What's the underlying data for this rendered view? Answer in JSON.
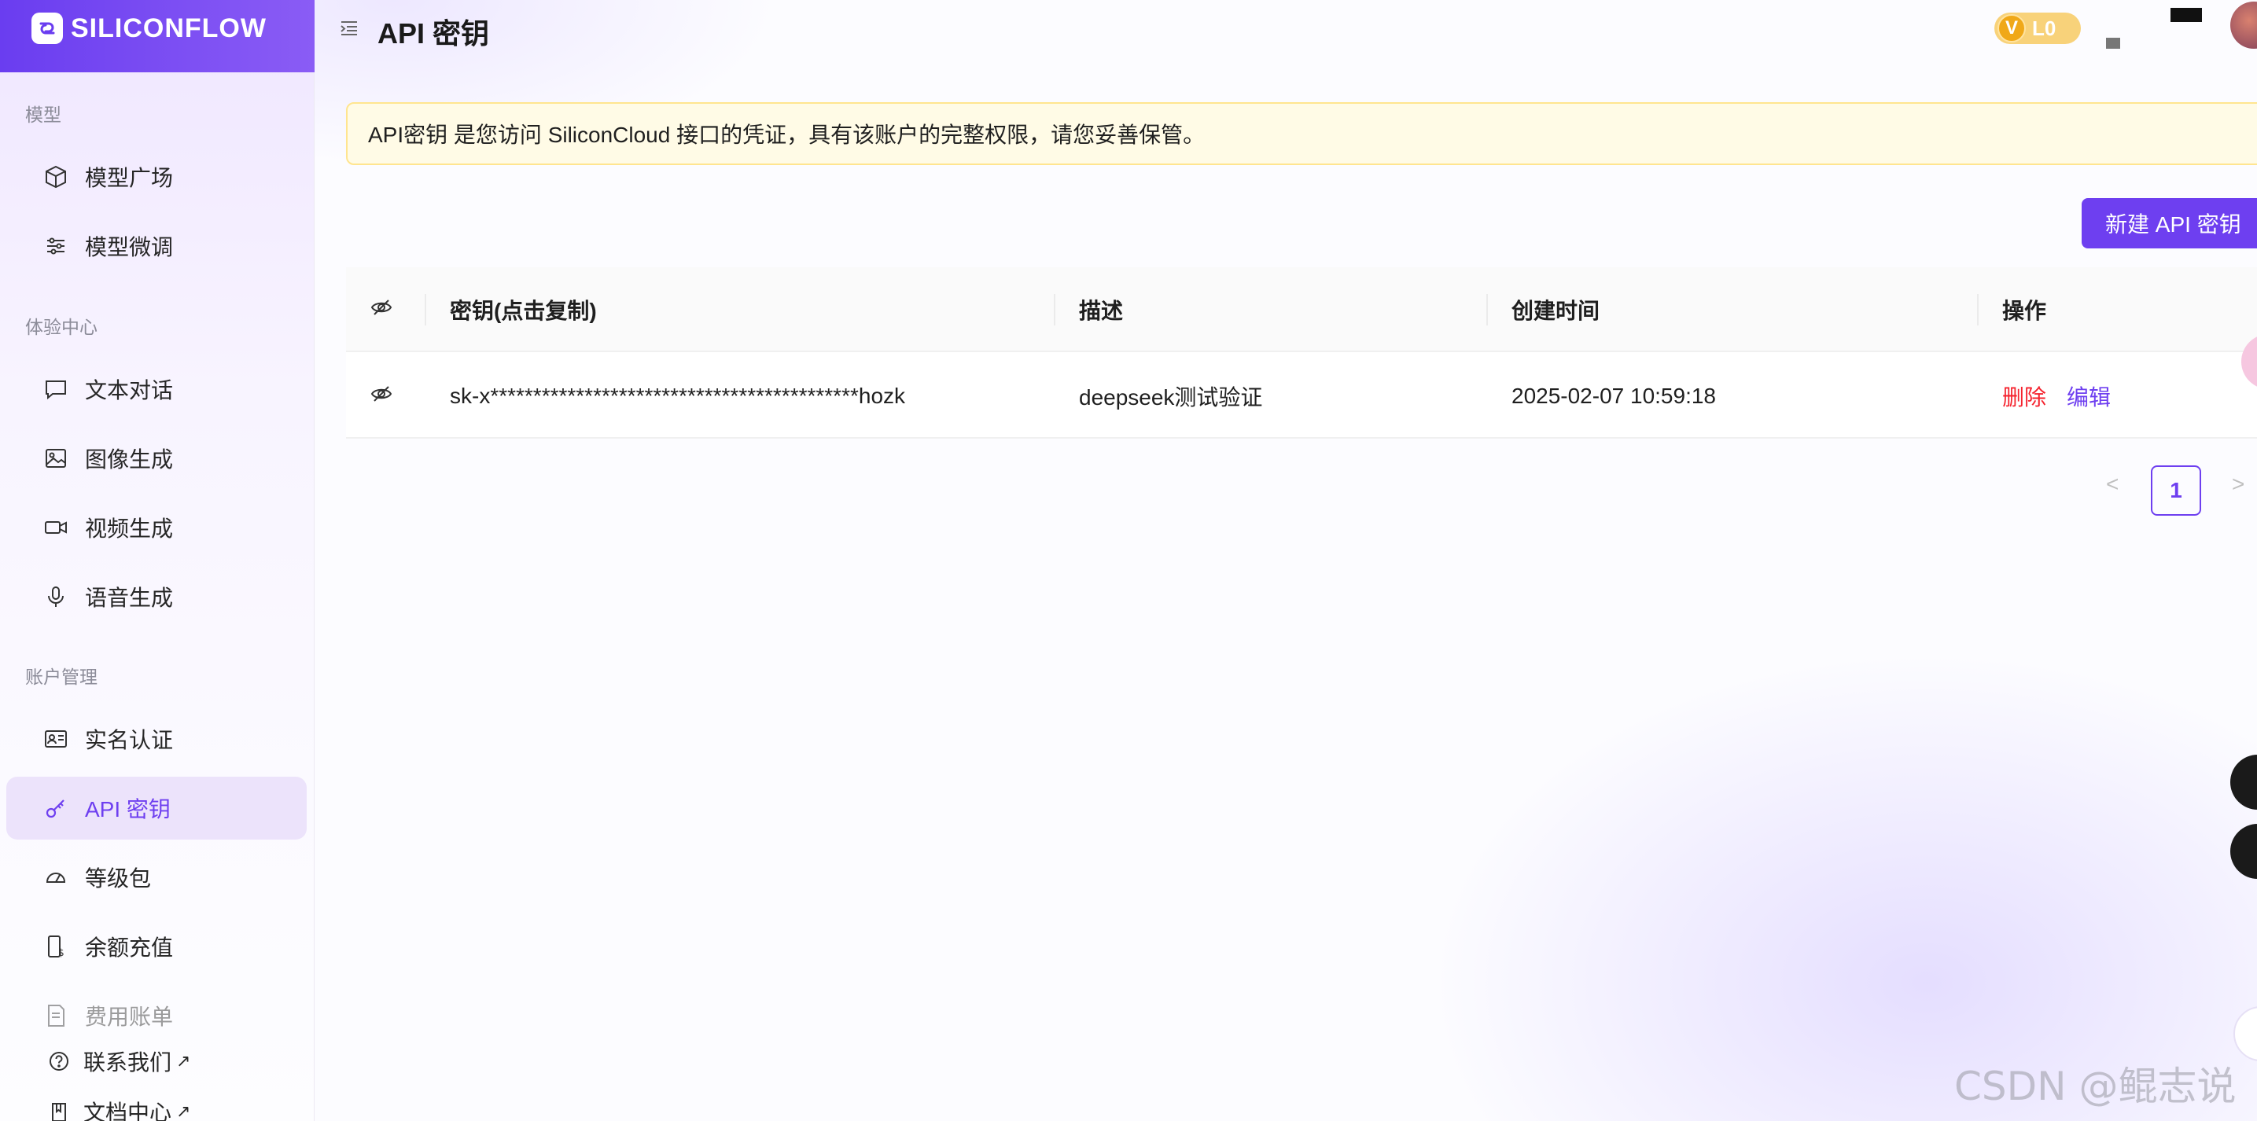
{
  "app": {
    "logo_text": "SILICONFLOW"
  },
  "sidebar": {
    "sections": [
      {
        "label": "模型"
      },
      {
        "label": "体验中心"
      },
      {
        "label": "账户管理"
      }
    ],
    "items": [
      {
        "label": "模型广场",
        "icon": "cube-icon"
      },
      {
        "label": "模型微调",
        "icon": "sliders-icon"
      },
      {
        "label": "文本对话",
        "icon": "chat-bubble-icon"
      },
      {
        "label": "图像生成",
        "icon": "image-icon"
      },
      {
        "label": "视频生成",
        "icon": "video-camera-icon"
      },
      {
        "label": "语音生成",
        "icon": "microphone-icon"
      },
      {
        "label": "实名认证",
        "icon": "id-card-icon"
      },
      {
        "label": "API 密钥",
        "icon": "key-icon",
        "active": true
      },
      {
        "label": "等级包",
        "icon": "gauge-icon"
      },
      {
        "label": "余额充值",
        "icon": "recharge-icon"
      },
      {
        "label": "费用账单",
        "icon": "bill-icon"
      }
    ],
    "bottom_links": [
      {
        "label": "联系我们",
        "arrow": "↗",
        "icon": "help-circle-icon"
      },
      {
        "label": "文档中心",
        "arrow": "↗",
        "icon": "book-icon"
      }
    ]
  },
  "header": {
    "title": "API 密钥",
    "level_badge": {
      "letter": "V",
      "label": "L0"
    }
  },
  "notice": {
    "text": "API密钥 是您访问 SiliconCloud 接口的凭证，具有该账户的完整权限，请您妥善保管。"
  },
  "toolbar": {
    "new_key_label": "新建 API 密钥"
  },
  "table": {
    "columns": [
      "密钥(点击复制)",
      "描述",
      "创建时间",
      "操作"
    ],
    "rows": [
      {
        "key": "sk-x*******************************************hozk",
        "description": "deepseek测试验证",
        "created": "2025-02-07 10:59:18",
        "actions": {
          "delete": "删除",
          "edit": "编辑"
        }
      }
    ]
  },
  "pagination": {
    "prev": "<",
    "current": "1",
    "next": ">"
  },
  "watermark": "CSDN @鲲志说",
  "colors": {
    "accent": "#6e3ff0",
    "danger": "#f5222d",
    "notice_bg": "#fffbe6",
    "notice_border": "#ffe58f"
  }
}
